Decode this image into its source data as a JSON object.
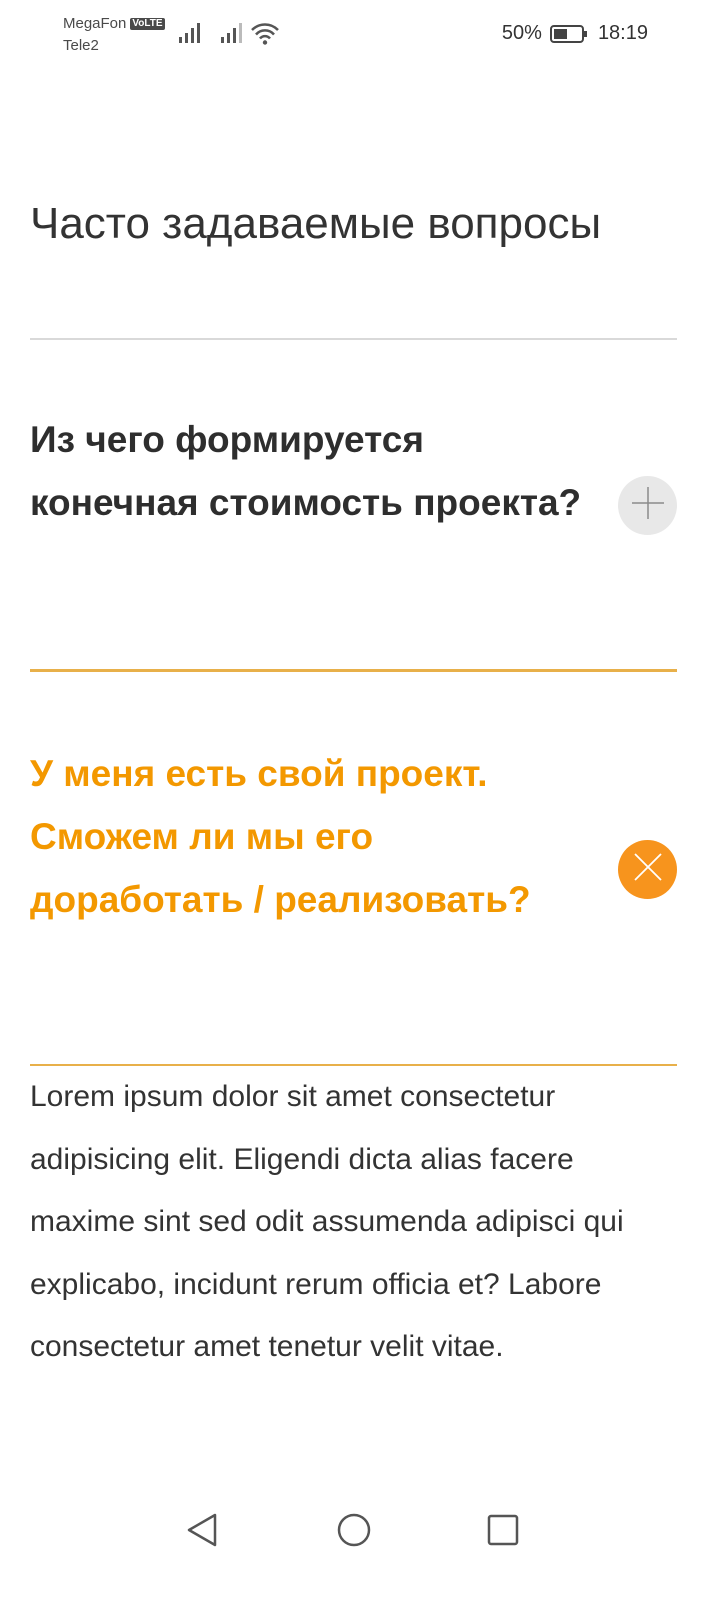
{
  "status_bar": {
    "carrier_1": "MegaFon",
    "volte_badge": "VoLTE",
    "carrier_2": "Tele2",
    "battery_percent": "50%",
    "battery_level": 0.5,
    "time": "18:19",
    "icons": [
      "signal-icon",
      "signal-icon",
      "wifi-icon",
      "battery-icon"
    ]
  },
  "page": {
    "title": "Часто задаваемые вопросы"
  },
  "faq": {
    "items": [
      {
        "question": "Из чего формируется конечная стоимость проекта?",
        "expanded": false,
        "toggle_icon": "plus-icon"
      },
      {
        "question": "У меня есть свой проект. Сможем ли мы его доработать / реализовать?",
        "expanded": true,
        "toggle_icon": "close-icon",
        "answer": "Lorem ipsum dolor sit amet consectetur adipisicing elit. Eligendi dicta alias facere maxime sint sed odit assumenda adipisci qui explicabo, incidunt rerum officia et? Labore consectetur amet tenetur velit vitae."
      }
    ]
  },
  "colors": {
    "accent": "#f39800",
    "accent_button": "#f7941d",
    "divider_accent": "#e8b04a",
    "divider_gray": "#d9d9d9",
    "toggle_gray": "#e8e8e8",
    "text": "#333333"
  },
  "nav_bar": {
    "icons": [
      "back-icon",
      "home-icon",
      "recent-apps-icon"
    ]
  }
}
